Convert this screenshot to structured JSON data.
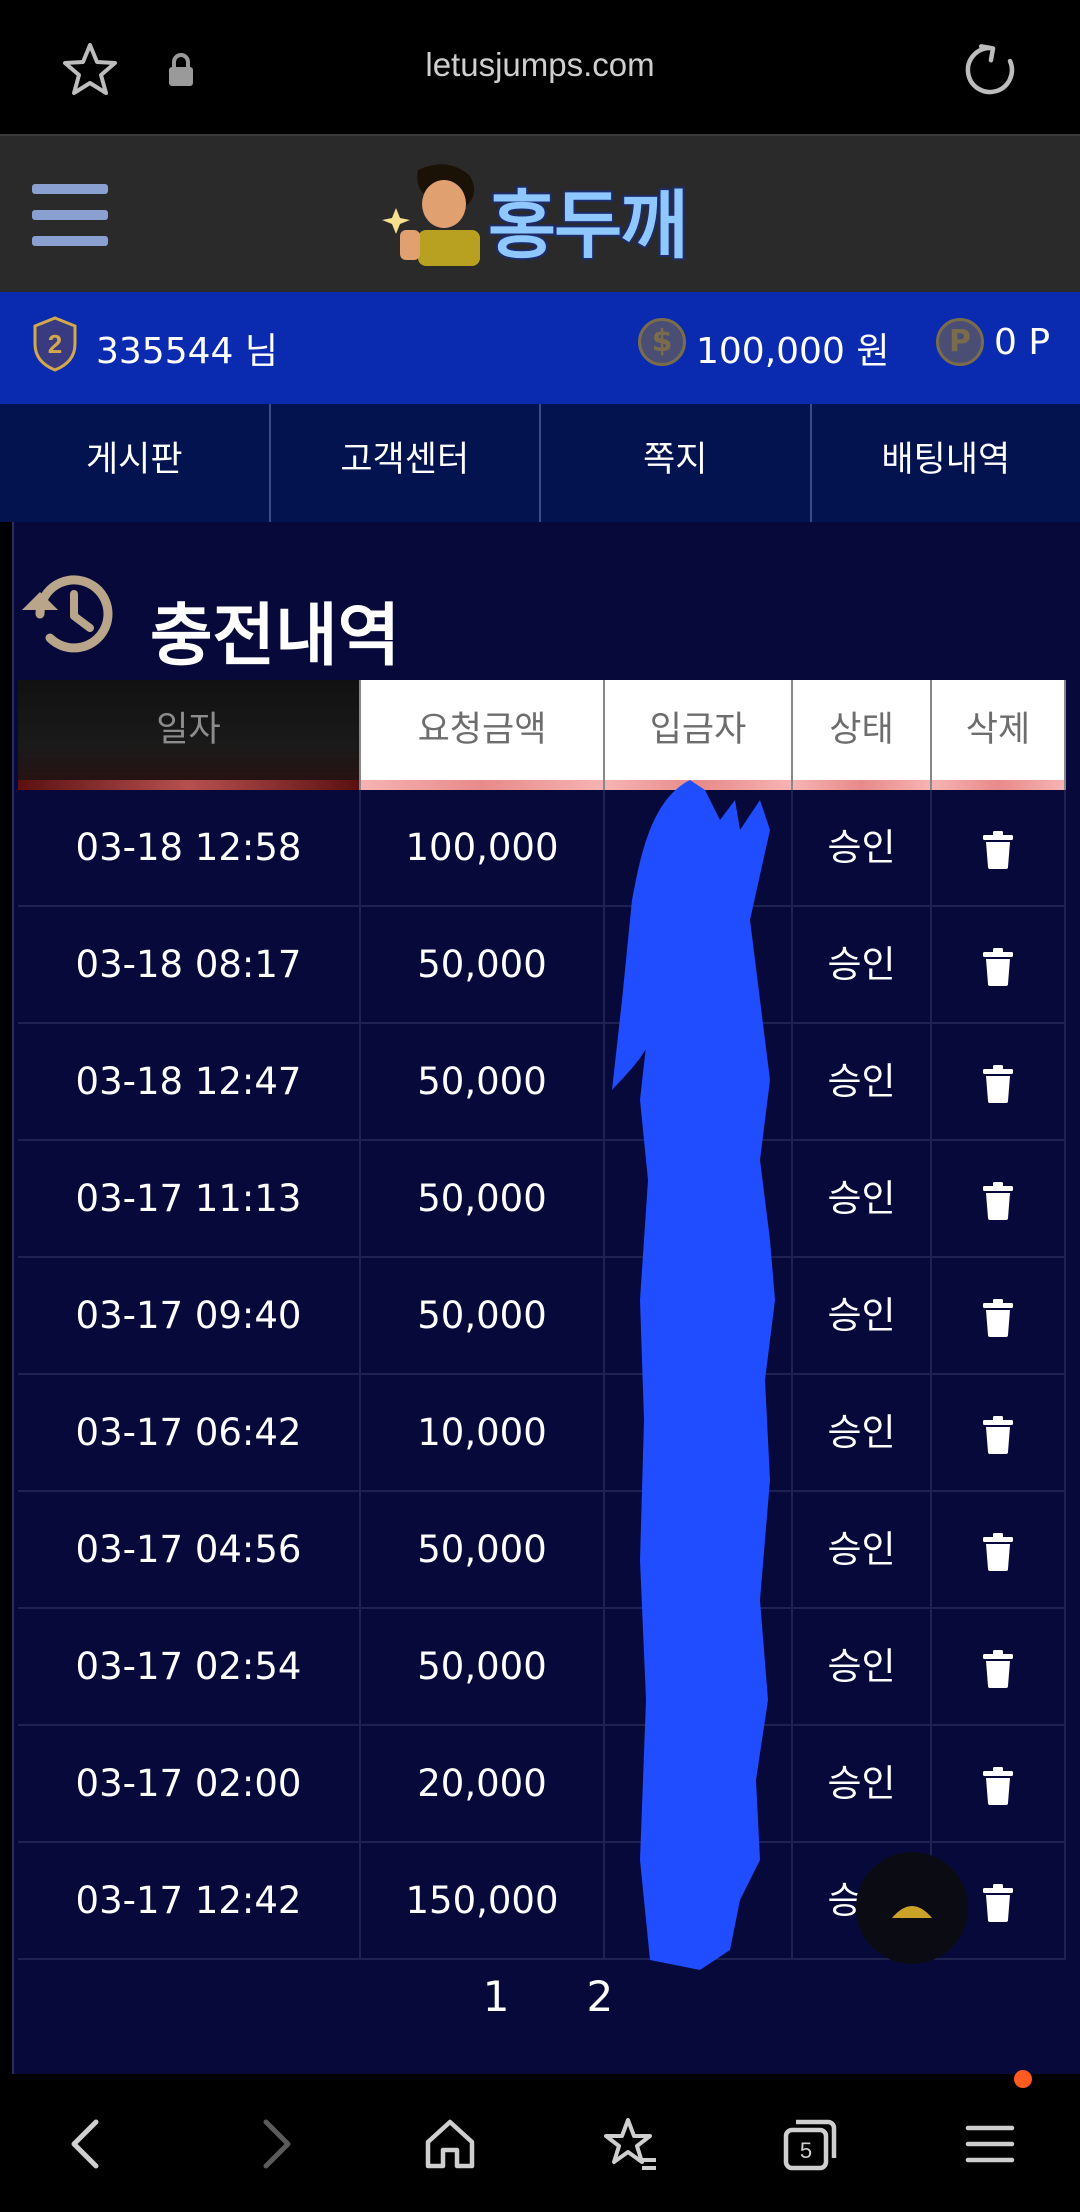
{
  "browser": {
    "url": "letusjumps.com",
    "tab_count": "5"
  },
  "site": {
    "logo_text": "홍두깨"
  },
  "user": {
    "level": "2",
    "name": "335544 님",
    "money": "100,000 원",
    "points": "0 P",
    "coin_symbol": "$",
    "point_symbol": "P"
  },
  "tabs": [
    "게시판",
    "고객센터",
    "쪽지",
    "배팅내역"
  ],
  "section": {
    "title": "충전내역"
  },
  "table": {
    "headers": [
      "일자",
      "요청금액",
      "입금자",
      "상태",
      "삭제"
    ],
    "rows": [
      {
        "date": "03-18 12:58",
        "amount": "100,000",
        "depositor": "",
        "status": "승인"
      },
      {
        "date": "03-18 08:17",
        "amount": "50,000",
        "depositor": "",
        "status": "승인"
      },
      {
        "date": "03-18 12:47",
        "amount": "50,000",
        "depositor": "",
        "status": "승인"
      },
      {
        "date": "03-17 11:13",
        "amount": "50,000",
        "depositor": "",
        "status": "승인"
      },
      {
        "date": "03-17 09:40",
        "amount": "50,000",
        "depositor": "",
        "status": "승인"
      },
      {
        "date": "03-17 06:42",
        "amount": "10,000",
        "depositor": "",
        "status": "승인"
      },
      {
        "date": "03-17 04:56",
        "amount": "50,000",
        "depositor": "",
        "status": "승인"
      },
      {
        "date": "03-17 02:54",
        "amount": "50,000",
        "depositor": "",
        "status": "승인"
      },
      {
        "date": "03-17 02:00",
        "amount": "20,000",
        "depositor": "",
        "status": "승인"
      },
      {
        "date": "03-17 12:42",
        "amount": "150,000",
        "depositor": "",
        "status": "승인"
      }
    ]
  },
  "pagination": {
    "pages": [
      "1",
      "2"
    ],
    "current": "1"
  },
  "colors": {
    "user_bar": "#0a2bb0",
    "tabs_bg": "#031350",
    "content_bg": "#06093a",
    "redaction": "#1f4dff"
  }
}
